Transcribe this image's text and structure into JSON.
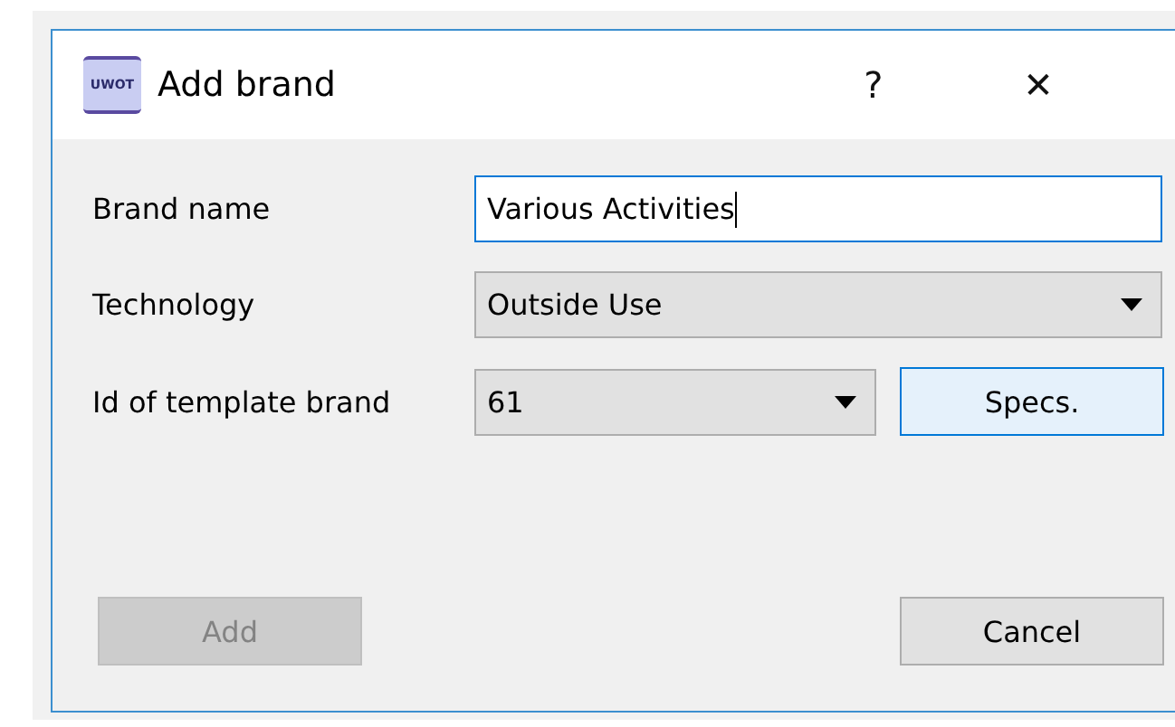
{
  "window": {
    "title": "Add brand",
    "logo_text": "UWOT",
    "help": "?",
    "close": "✕"
  },
  "fields": [
    {
      "kind": "text",
      "label": "Brand name",
      "value": "Various Activities",
      "focused": true
    },
    {
      "kind": "combo",
      "label": "Technology",
      "value": "Outside Use"
    },
    {
      "kind": "combo",
      "label": "Id of template brand",
      "value": "61",
      "button": {
        "label": "Specs.",
        "focused": true
      }
    }
  ],
  "buttons": [
    {
      "label": "Add",
      "disabled": true
    },
    {
      "label": "Cancel",
      "disabled": false
    }
  ]
}
